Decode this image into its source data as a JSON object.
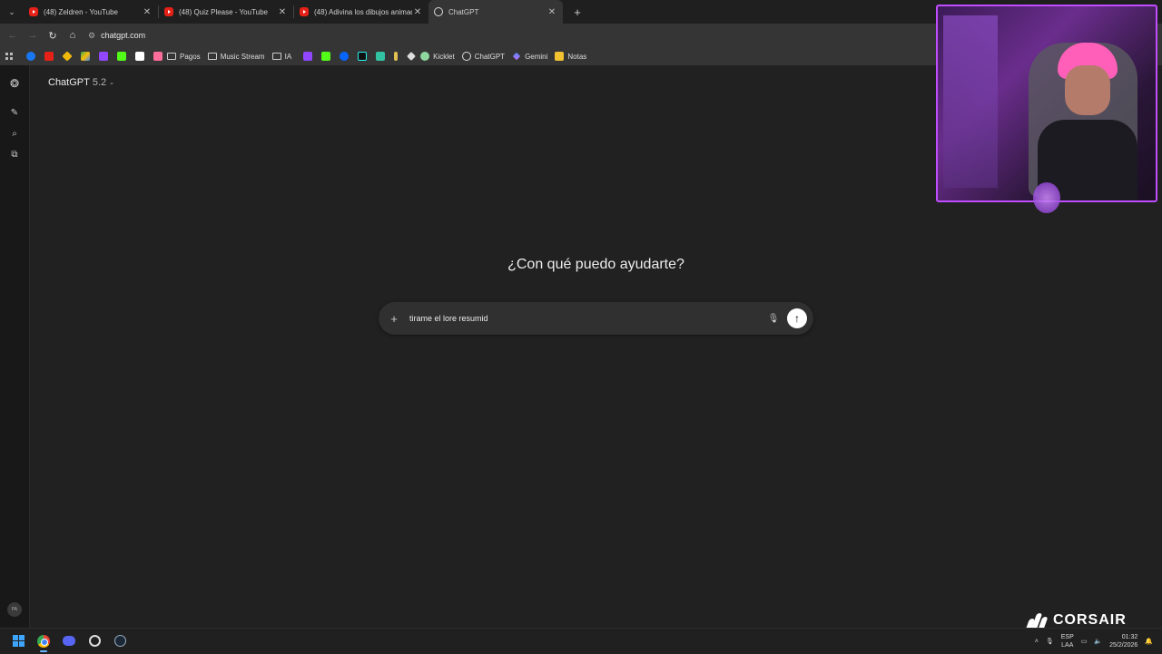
{
  "browser": {
    "tabs": [
      {
        "title": "(48) Zeldren - YouTube",
        "icon": "youtube-icon"
      },
      {
        "title": "(48) Quiz Please - YouTube",
        "icon": "youtube-icon"
      },
      {
        "title": "(48) Adivina los dibujos animad",
        "icon": "youtube-icon"
      },
      {
        "title": "ChatGPT",
        "icon": "chatgpt-icon",
        "active": true
      }
    ],
    "url": "chatgpt.com",
    "bookmarks": [
      {
        "label": "Pagos",
        "type": "folder"
      },
      {
        "label": "Music Stream",
        "type": "folder"
      },
      {
        "label": "IA",
        "type": "folder"
      },
      {
        "label": "Kicklet",
        "type": "site"
      },
      {
        "label": "ChatGPT",
        "type": "site"
      },
      {
        "label": "Gemini",
        "type": "site"
      },
      {
        "label": "Notas",
        "type": "site"
      }
    ]
  },
  "chatgpt": {
    "model_name": "ChatGPT",
    "model_version": "5.2",
    "heading": "¿Con qué puedo ayudarte?",
    "prompt_value": "tirame el lore resumid",
    "avatar_initials": "PA"
  },
  "overlay": {
    "brand": "CORSAIR"
  },
  "taskbar": {
    "lang_line1": "ESP",
    "lang_line2": "LAA",
    "time": "01:32",
    "date": "25/2/2026"
  },
  "colors": {
    "accent_purple": "#c04dff",
    "background": "#212121",
    "composer": "#303030"
  }
}
